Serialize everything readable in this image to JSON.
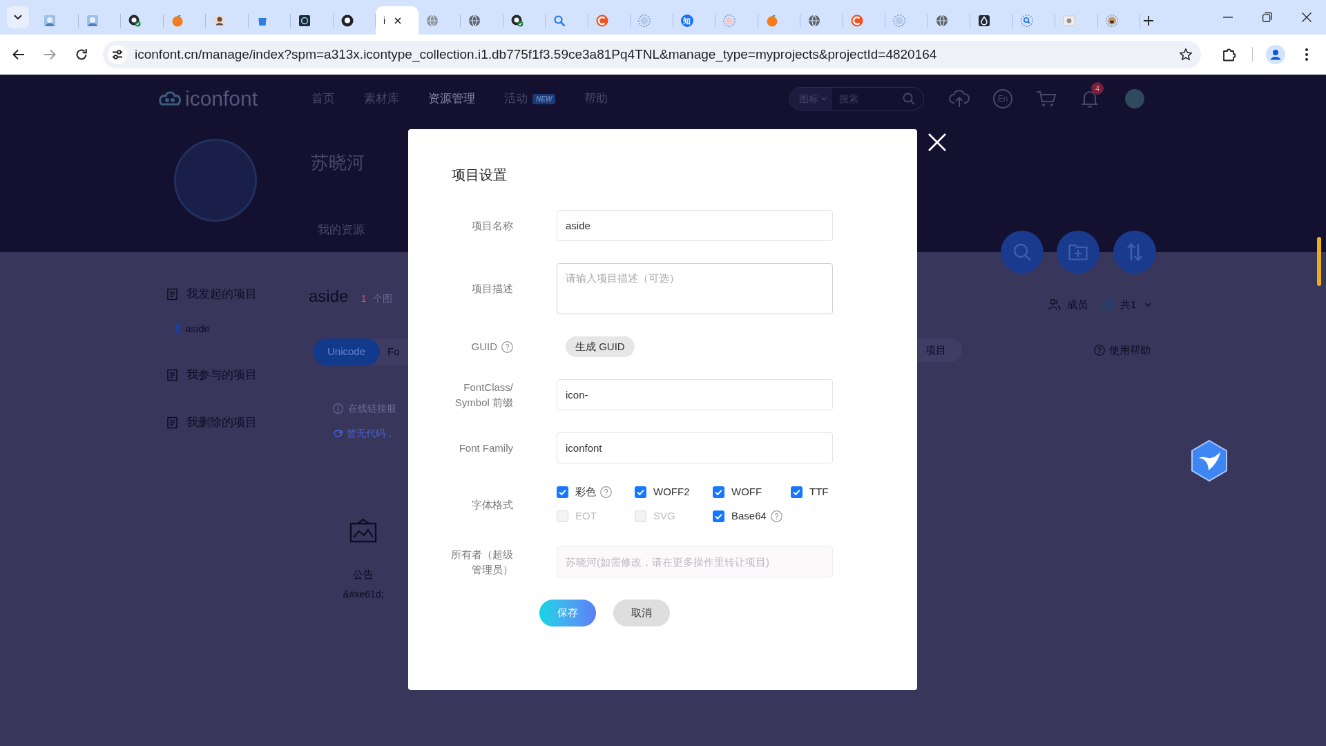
{
  "browser": {
    "tabs": [
      {
        "selected": false
      },
      {
        "selected": false
      },
      {
        "selected": false
      },
      {
        "selected": false
      },
      {
        "selected": false
      },
      {
        "selected": false
      },
      {
        "selected": false
      },
      {
        "selected": false
      },
      {
        "title": "i",
        "selected": true
      },
      {
        "selected": false
      },
      {
        "selected": false
      },
      {
        "selected": false
      },
      {
        "selected": false
      },
      {
        "selected": false
      },
      {
        "selected": false
      },
      {
        "icon_text": "知",
        "selected": false
      },
      {
        "selected": false
      },
      {
        "selected": false
      },
      {
        "selected": false
      },
      {
        "selected": false
      },
      {
        "selected": false
      },
      {
        "selected": false
      },
      {
        "selected": false
      },
      {
        "selected": false
      },
      {
        "selected": false
      },
      {
        "selected": false
      }
    ],
    "address": "iconfont.cn/manage/index?spm=a313x.icontype_collection.i1.db775f1f3.59ce3a81Pq4TNL&manage_type=myprojects&projectId=4820164"
  },
  "site_header": {
    "logo": "iconfont",
    "nav": [
      {
        "label": "首页",
        "selected": false
      },
      {
        "label": "素材库",
        "selected": false
      },
      {
        "label": "资源管理",
        "selected": true
      },
      {
        "label": "活动",
        "badge": "NEW",
        "selected": false
      },
      {
        "label": "帮助",
        "selected": false
      }
    ],
    "search": {
      "category": "图标",
      "placeholder": "搜索"
    },
    "language": "En",
    "notification_count": "4"
  },
  "profile": {
    "name": "苏晓河",
    "tabs": [
      {
        "label": "我的资源"
      }
    ]
  },
  "sidebar": {
    "groups": [
      {
        "label": "我发起的项目",
        "children": [
          {
            "label": "aside",
            "selected": true
          }
        ]
      },
      {
        "label": "我参与的项目"
      },
      {
        "label": "我删除的项目"
      }
    ]
  },
  "project": {
    "title": "aside",
    "icon_count": "1",
    "icon_count_unit": "个图",
    "tabs": [
      {
        "label": "Unicode",
        "selected": true
      },
      {
        "label": "Fo",
        "selected": false
      }
    ],
    "notice": "在线链接服",
    "code_link": "暂无代码，",
    "icons": [
      {
        "name": "公告",
        "code": "&#xe61d;"
      }
    ],
    "action_button": "项目",
    "members": {
      "label": "成员",
      "count": "共1"
    },
    "help_link": "使用帮助"
  },
  "dialog": {
    "title": "项目设置",
    "fields": [
      {
        "kind": "text",
        "label": "项目名称",
        "value": "aside",
        "disabled": false
      },
      {
        "kind": "textarea",
        "label": "项目描述",
        "placeholder": "请输入项目描述（可选）"
      },
      {
        "kind": "button",
        "label": "GUID",
        "help": true,
        "button": "生成 GUID"
      },
      {
        "kind": "text",
        "label": "FontClass/ Symbol 前缀",
        "value": "icon-",
        "disabled": false
      },
      {
        "kind": "text",
        "label": "Font Family",
        "value": "iconfont",
        "disabled": false
      },
      {
        "kind": "checkboxes",
        "label": "字体格式",
        "options": [
          {
            "label": "彩色",
            "checked": true,
            "disabled": false,
            "help": true
          },
          {
            "label": "WOFF2",
            "checked": true,
            "disabled": false,
            "help": false
          },
          {
            "label": "WOFF",
            "checked": true,
            "disabled": false,
            "help": false
          },
          {
            "label": "TTF",
            "checked": true,
            "disabled": false,
            "help": false
          },
          {
            "label": "EOT",
            "checked": false,
            "disabled": true,
            "help": false
          },
          {
            "label": "SVG",
            "checked": false,
            "disabled": true,
            "help": false
          },
          {
            "label": "Base64",
            "checked": true,
            "disabled": false,
            "help": true
          }
        ]
      },
      {
        "kind": "text",
        "label": "所有者（超级管理员）",
        "placeholder": "苏晓河(如需修改，请在更多操作里转让项目)",
        "disabled": true
      }
    ],
    "buttons": [
      {
        "label": "保存",
        "kind": "primary"
      },
      {
        "label": "取消",
        "kind": "default"
      }
    ]
  }
}
